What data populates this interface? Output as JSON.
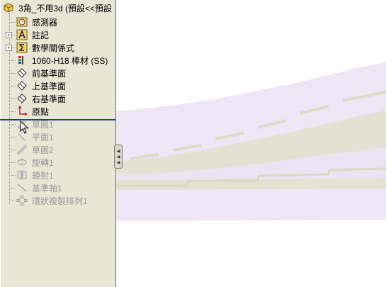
{
  "tree": {
    "root_label": "3角_不用3d (預設<<預設",
    "items": [
      {
        "label": "感測器",
        "icon": "sensor-icon",
        "suppressed": false,
        "expander": false
      },
      {
        "label": "註記",
        "icon": "annotation-icon",
        "suppressed": false,
        "expander": true
      },
      {
        "label": "數學關係式",
        "icon": "equation-icon",
        "suppressed": false,
        "expander": true
      },
      {
        "label": "1060-H18 棒材 (SS)",
        "icon": "material-icon",
        "suppressed": false,
        "expander": false
      },
      {
        "label": "前基準面",
        "icon": "plane-icon",
        "suppressed": false,
        "expander": false
      },
      {
        "label": "上基準面",
        "icon": "plane-icon",
        "suppressed": false,
        "expander": false
      },
      {
        "label": "右基準面",
        "icon": "plane-icon",
        "suppressed": false,
        "expander": false
      },
      {
        "label": "原點",
        "icon": "origin-icon",
        "suppressed": false,
        "expander": false
      },
      {
        "label": "草圖1",
        "icon": "sketch-icon",
        "suppressed": true,
        "expander": false
      },
      {
        "label": "平面1",
        "icon": "plane-icon",
        "suppressed": true,
        "expander": false
      },
      {
        "label": "草圖2",
        "icon": "sketch-icon",
        "suppressed": true,
        "expander": false
      },
      {
        "label": "旋轉1",
        "icon": "revolve-icon",
        "suppressed": true,
        "expander": false
      },
      {
        "label": "鏡射1",
        "icon": "mirror-icon",
        "suppressed": true,
        "expander": false
      },
      {
        "label": "基準軸1",
        "icon": "axis-icon",
        "suppressed": true,
        "expander": false
      },
      {
        "label": "環狀複製排列1",
        "icon": "circular-pattern-icon",
        "suppressed": true,
        "expander": false
      }
    ],
    "expander_symbol": "+"
  },
  "colors": {
    "panel_bg": "#e8e6d5",
    "rollback_bar": "#1f3f8a",
    "model_lavender": "#ece6f5",
    "model_olive": "#e2e2d2",
    "suppressed_text": "#9a9a9a"
  }
}
